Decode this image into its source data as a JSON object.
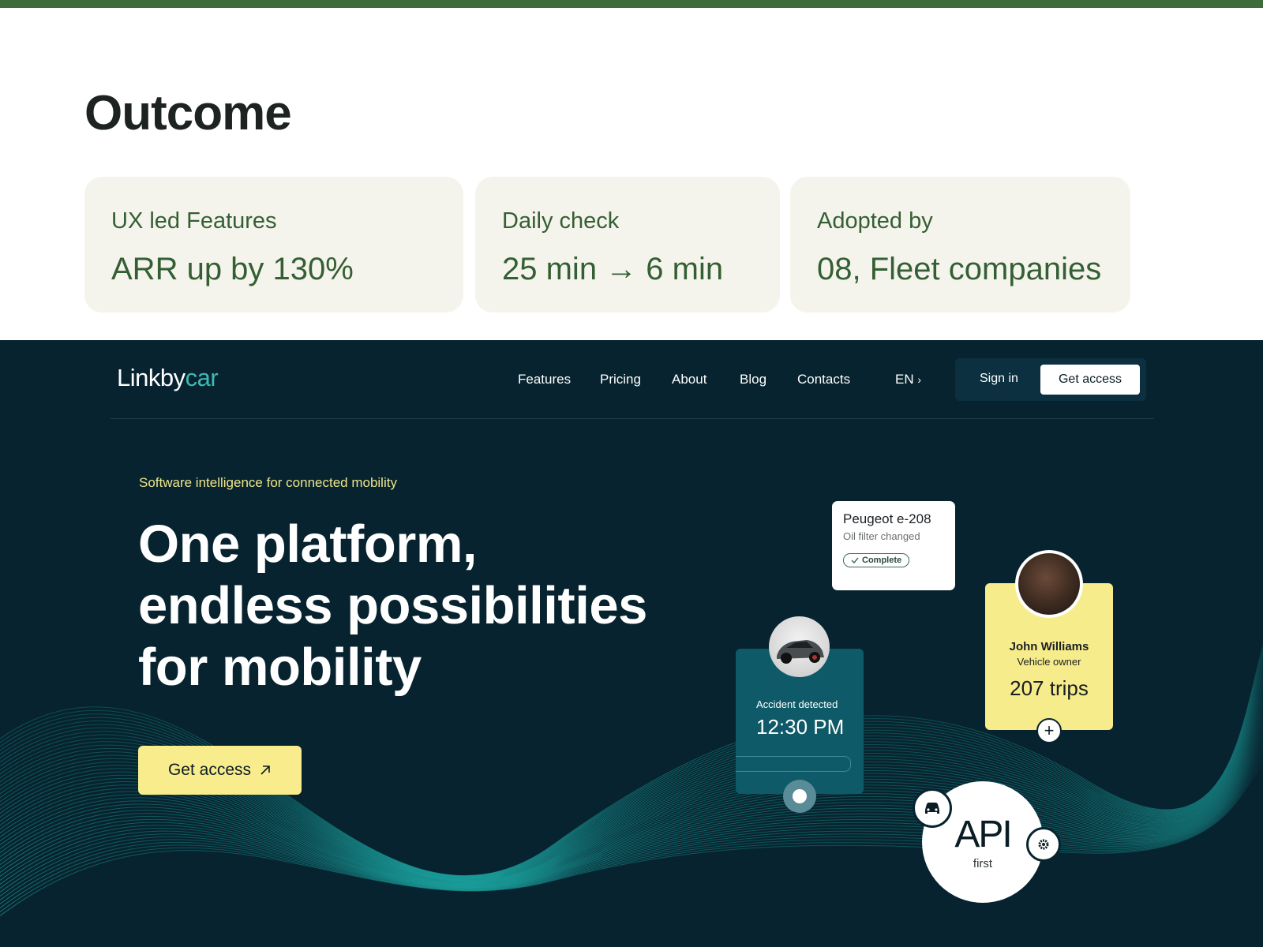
{
  "outcome": {
    "title": "Outcome",
    "cards": [
      {
        "label": "UX led Features",
        "value": "ARR up by 130%"
      },
      {
        "label": "Daily check",
        "value": "25 min → 6 min"
      },
      {
        "label": "Adopted by",
        "value": "08, Fleet companies"
      }
    ]
  },
  "hero": {
    "logo_main": "Linkby",
    "logo_accent": "car",
    "nav": [
      "Features",
      "Pricing",
      "About",
      "Blog",
      "Contacts"
    ],
    "language": "EN",
    "sign_in": "Sign in",
    "get_access_top": "Get access",
    "tagline": "Software intelligence for connected mobility",
    "headline_line1": "One platform,",
    "headline_line2": "endless possibilities",
    "headline_line3": "for mobility",
    "cta": "Get access",
    "peugeot": {
      "title": "Peugeot e-208",
      "sub": "Oil filter changed",
      "badge": "Complete"
    },
    "accident": {
      "label": "Accident detected",
      "time": "12:30 PM"
    },
    "john": {
      "name": "John Williams",
      "role": "Vehicle owner",
      "trips": "207 trips"
    },
    "api": {
      "big": "API",
      "small": "first"
    }
  },
  "colors": {
    "topbar": "#3d6b3a",
    "hero_bg": "#07232f",
    "accent_yellow": "#f8ec8c",
    "accent_teal": "#3fb9b4",
    "card_bg": "#f5f4ec",
    "card_text": "#345f34"
  },
  "icons": {
    "cta_arrow": "arrow-up-right-icon",
    "language": "chevron-right-icon",
    "badge": "check-icon",
    "api_car": "car-icon",
    "api_gear": "gear-icon",
    "john_add": "plus-icon"
  }
}
